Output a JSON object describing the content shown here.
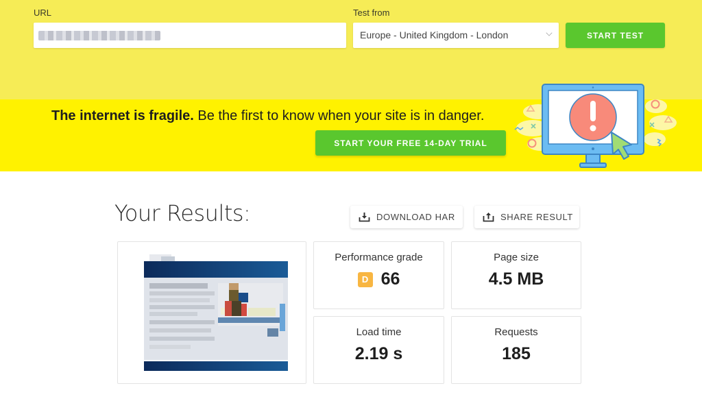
{
  "form": {
    "url_label": "URL",
    "url_value": "",
    "test_from_label": "Test from",
    "test_from_selected": "Europe - United Kingdom - London",
    "start_test_label": "START TEST"
  },
  "banner": {
    "headline_bold": "The internet is fragile.",
    "headline_rest": " Be the first to know when your site is in danger.",
    "cta_label": "START YOUR FREE 14-DAY TRIAL",
    "illustration": "monitor-alert-icon"
  },
  "results": {
    "title": "Your Results:",
    "download_har_label": "DOWNLOAD HAR",
    "share_result_label": "SHARE RESULT",
    "metrics": {
      "performance": {
        "label": "Performance grade",
        "grade": "D",
        "score": "66",
        "grade_color": "#f8b642"
      },
      "page_size": {
        "label": "Page size",
        "value": "4.5 MB"
      },
      "load_time": {
        "label": "Load time",
        "value": "2.19 s"
      },
      "requests": {
        "label": "Requests",
        "value": "185"
      }
    }
  },
  "colors": {
    "top_bg": "#f6ec56",
    "banner_bg": "#fff200",
    "accent_green": "#5ac72e"
  }
}
